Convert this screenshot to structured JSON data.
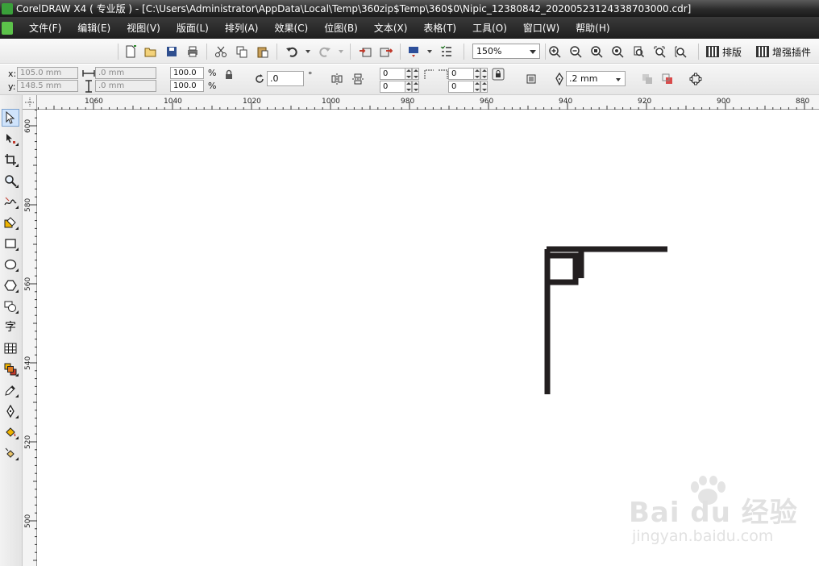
{
  "window": {
    "title": "CorelDRAW X4 ( 专业版 ) - [C:\\Users\\Administrator\\AppData\\Local\\Temp\\360zip$Temp\\360$0\\Nipic_12380842_20200523124338703000.cdr]"
  },
  "menu": [
    {
      "label": "文件(F)"
    },
    {
      "label": "编辑(E)"
    },
    {
      "label": "视图(V)"
    },
    {
      "label": "版面(L)"
    },
    {
      "label": "排列(A)"
    },
    {
      "label": "效果(C)"
    },
    {
      "label": "位图(B)"
    },
    {
      "label": "文本(X)"
    },
    {
      "label": "表格(T)"
    },
    {
      "label": "工具(O)"
    },
    {
      "label": "窗口(W)"
    },
    {
      "label": "帮助(H)"
    }
  ],
  "toolbar": {
    "icons": [
      "new-icon",
      "open-icon",
      "save-icon",
      "print-icon",
      "cut-icon",
      "copy-icon",
      "paste-icon",
      "undo-icon",
      "redo-icon",
      "import-icon",
      "export-icon",
      "application-launcher-icon",
      "welcome-screen-icon"
    ],
    "zoom_level": "150%",
    "zoom_icons": [
      "zoom-in-icon",
      "zoom-out-icon",
      "zoom-to-selected-icon",
      "zoom-to-all-icon",
      "zoom-to-page-icon",
      "zoom-to-width-icon",
      "zoom-to-height-icon"
    ],
    "layout_button": "排版",
    "plugin_button": "增强插件"
  },
  "property_bar": {
    "x_label": "x:",
    "y_label": "y:",
    "x_value": "105.0 mm",
    "y_value": "148.5 mm",
    "width_value": ".0 mm",
    "height_value": ".0 mm",
    "scale_x": "100.0",
    "scale_y": "100.0",
    "percent": "%",
    "rotation": ".0",
    "degree": "°",
    "pos_a1": "0",
    "pos_a2": "0",
    "pos_b1": "0",
    "pos_b2": "0",
    "outline_width": ".2 mm"
  },
  "rulers": {
    "horizontal_labels": [
      "1060",
      "1040",
      "1020",
      "1000",
      "980",
      "960",
      "940",
      "920",
      "900",
      "880"
    ],
    "vertical_labels": [
      "600",
      "580",
      "560",
      "540",
      "520",
      "500"
    ]
  },
  "tools": [
    {
      "name": "pick-tool",
      "icon": "arrow-icon"
    },
    {
      "name": "shape-tool",
      "icon": "shape-edit-icon"
    },
    {
      "name": "crop-tool",
      "icon": "crop-icon"
    },
    {
      "name": "zoom-tool",
      "icon": "magnifier-icon"
    },
    {
      "name": "freehand-tool",
      "icon": "freehand-icon"
    },
    {
      "name": "smart-fill-tool",
      "icon": "smart-fill-icon"
    },
    {
      "name": "rectangle-tool",
      "icon": "rectangle-icon"
    },
    {
      "name": "ellipse-tool",
      "icon": "ellipse-icon"
    },
    {
      "name": "polygon-tool",
      "icon": "polygon-icon"
    },
    {
      "name": "basic-shapes-tool",
      "icon": "basic-shapes-icon"
    },
    {
      "name": "text-tool",
      "icon": "text-icon",
      "glyph": "字"
    },
    {
      "name": "table-tool",
      "icon": "table-icon"
    },
    {
      "name": "interactive-blend-tool",
      "icon": "blend-icon"
    },
    {
      "name": "eyedropper-tool",
      "icon": "eyedropper-icon"
    },
    {
      "name": "outline-tool",
      "icon": "pen-nib-icon"
    },
    {
      "name": "fill-tool",
      "icon": "fill-bucket-icon"
    },
    {
      "name": "interactive-fill-tool",
      "icon": "interactive-fill-icon"
    }
  ],
  "canvas": {
    "artwork_color": "#231f20"
  },
  "watermark": {
    "brand": "Bai du 经验",
    "url": "jingyan.baidu.com"
  }
}
